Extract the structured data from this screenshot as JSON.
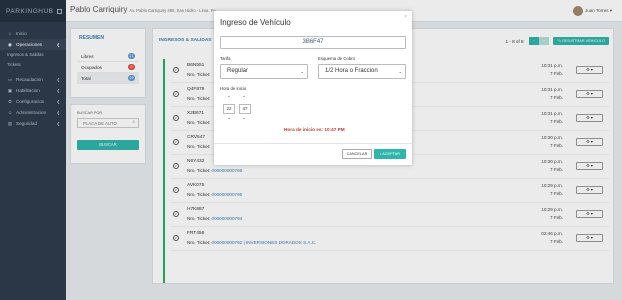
{
  "brand": {
    "name": "PARKINGHUB"
  },
  "header": {
    "user_name": "Pablo Carriquiry",
    "address": "Av. Pablo Carriquiry 480, San Isidro - Lima, Pe",
    "account": "Juan Torres"
  },
  "sidebar": {
    "items": [
      {
        "label": "Inicio",
        "icon": "home-icon",
        "glyph": "⌂"
      },
      {
        "label": "Operaciones",
        "icon": "wifi-icon",
        "glyph": "◉"
      },
      {
        "label": "Recaudacion",
        "icon": "wallet-icon",
        "glyph": "▭"
      },
      {
        "label": "Habilitacion",
        "icon": "cube-icon",
        "glyph": "▣"
      },
      {
        "label": "Configuracion",
        "icon": "gear-icon",
        "glyph": "⚙"
      },
      {
        "label": "Administracion",
        "icon": "user-icon",
        "glyph": "☺"
      },
      {
        "label": "Seguridad",
        "icon": "lock-icon",
        "glyph": "▥"
      }
    ],
    "sub_items": [
      "Ingresos & Salidas",
      "Tickets"
    ]
  },
  "summary": {
    "title": "RESUMEN",
    "rows": [
      {
        "label": "Libres",
        "count": "21",
        "color": "#5b9bd5"
      },
      {
        "label": "Ocupados",
        "count": "8",
        "color": "#e74c3c"
      },
      {
        "label": "Total",
        "count": "29",
        "color": "#5b9bd5"
      }
    ]
  },
  "search": {
    "label": "BUSCAR POR",
    "placeholder": "PLACA DE AUTO",
    "button": "BUSCAR"
  },
  "main": {
    "title": "INGRESOS & SALIDAS",
    "pager_count": "1 - 8 of 8",
    "prev": "‹",
    "next": "›",
    "register_button": "REGISTRAR VEHICULO",
    "ticket_label": "Nro. Ticket:",
    "rows": [
      {
        "plate": "B6N551",
        "ticket": "",
        "time": "10:31 p.m.",
        "date": "7 Feb."
      },
      {
        "plate": "Q4F879",
        "ticket": "",
        "time": "10:31 p.m.",
        "date": "7 Feb."
      },
      {
        "plate": "X2B671",
        "ticket": "",
        "time": "10:31 p.m.",
        "date": "7 Feb."
      },
      {
        "plate": "CRV547",
        "ticket": "",
        "time": "10:30 p.m.",
        "date": "7 Feb."
      },
      {
        "plate": "N6Y432",
        "ticket": "000000000786",
        "time": "10:30 p.m.",
        "date": "7 Feb."
      },
      {
        "plate": "AVK075",
        "ticket": "000000000795",
        "time": "10:29 p.m.",
        "date": "7 Feb."
      },
      {
        "plate": "H7K887",
        "ticket": "000000000794",
        "time": "10:29 p.m.",
        "date": "7 Feb."
      },
      {
        "plate": "FRT456",
        "ticket": "000000000792 | INVERSIONES DORADOS S.A.C.",
        "time": "02:46 p.m.",
        "date": "7 Feb."
      }
    ]
  },
  "modal": {
    "title": "Ingreso de Vehículo",
    "close": "×",
    "plate_value": "3B6F47",
    "tarifa_label": "Tarifa",
    "tarifa_value": "Regular",
    "cobro_label": "Esquema de Cobro",
    "cobro_value": "1/2 Hora o Fraccion",
    "hora_label": "Hora de inicio",
    "hour": "22",
    "minute": "47",
    "colon": ":",
    "up": "⌃",
    "down": "⌄",
    "hint": "Hora de inicio es: 10:47 PM",
    "cancel": "CANCELAR",
    "accept": "ACEPTAR"
  }
}
